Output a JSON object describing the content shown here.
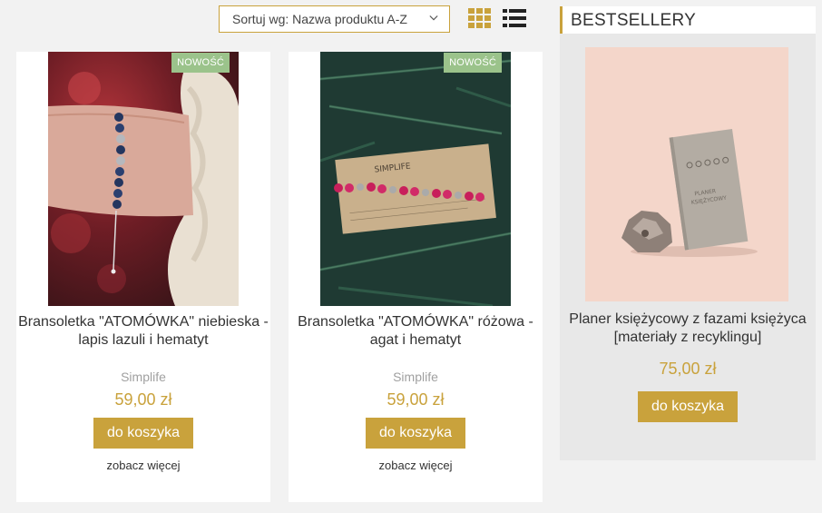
{
  "sort": {
    "label": "Sortuj wg: Nazwa produktu A-Z"
  },
  "products": [
    {
      "badge": "NOWOŚĆ",
      "name": "Bransoletka \"ATOMÓWKA\" niebieska - lapis lazuli i hematyt",
      "brand": "Simplife",
      "price": "59,00 zł",
      "cart_label": "do koszyka",
      "more_label": "zobacz więcej"
    },
    {
      "badge": "NOWOŚĆ",
      "name": "Bransoletka \"ATOMÓWKA\" różowa - agat i hematyt",
      "brand": "Simplife",
      "price": "59,00 zł",
      "cart_label": "do koszyka",
      "more_label": "zobacz więcej"
    }
  ],
  "bestsellers": {
    "title": "BESTSELLERY",
    "item": {
      "name": "Planer księżycowy z fazami księżyca [materiały z recyklingu]",
      "price": "75,00 zł",
      "cart_label": "do koszyka"
    }
  },
  "colors": {
    "accent": "#c9a23c",
    "badge": "#9bc38b",
    "page_bg": "#f2f2f2",
    "sidebar_bg": "#e8e8e8"
  },
  "icons": [
    "chevron-down-icon",
    "grid-view-icon",
    "list-view-icon"
  ]
}
